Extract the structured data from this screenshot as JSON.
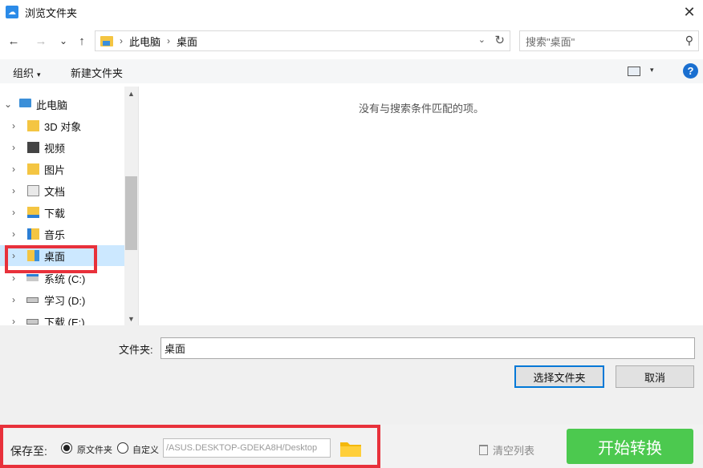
{
  "window": {
    "title": "浏览文件夹",
    "close_glyph": "✕"
  },
  "nav": {
    "back": "←",
    "forward": "→",
    "recent": "⌄",
    "up": "↑"
  },
  "address": {
    "crumbs": [
      "此电脑",
      "桌面"
    ],
    "sep": "›",
    "drop": "⌄",
    "refresh": "↻"
  },
  "search": {
    "placeholder": "搜索\"桌面\"",
    "icon": "⚲"
  },
  "toolbar": {
    "organize": "组织",
    "caret": "▾",
    "new_folder": "新建文件夹",
    "help": "?"
  },
  "tree": {
    "root": "此电脑",
    "items": [
      {
        "label": "3D 对象",
        "icon": "3d-objects-folder-icon"
      },
      {
        "label": "视频",
        "icon": "videos-folder-icon"
      },
      {
        "label": "图片",
        "icon": "pictures-folder-icon"
      },
      {
        "label": "文档",
        "icon": "documents-folder-icon"
      },
      {
        "label": "下载",
        "icon": "downloads-folder-icon"
      },
      {
        "label": "音乐",
        "icon": "music-folder-icon"
      },
      {
        "label": "桌面",
        "icon": "desktop-folder-icon",
        "selected": true
      },
      {
        "label": "系统 (C:)",
        "icon": "windows-drive-icon"
      },
      {
        "label": "学习 (D:)",
        "icon": "drive-icon"
      },
      {
        "label": "下载 (E:)",
        "icon": "drive-icon"
      }
    ],
    "chevron_right": "›",
    "chevron_down": "⌄"
  },
  "scroll": {
    "up": "▲",
    "down": "▼"
  },
  "content": {
    "empty_message": "没有与搜索条件匹配的项。"
  },
  "folder": {
    "label": "文件夹:",
    "value": "桌面"
  },
  "buttons": {
    "select": "选择文件夹",
    "cancel": "取消"
  },
  "footer": {
    "save_to": "保存至:",
    "opt_original": "原文件夹",
    "opt_custom": "自定义",
    "path": "/ASUS.DESKTOP-GDEKA8H/Desktop",
    "clear": "清空列表",
    "start": "开始转换"
  },
  "colors": {
    "highlight": "#e8313b",
    "accent": "#0078d7",
    "start": "#4cc94f",
    "selected": "#cce8ff"
  }
}
